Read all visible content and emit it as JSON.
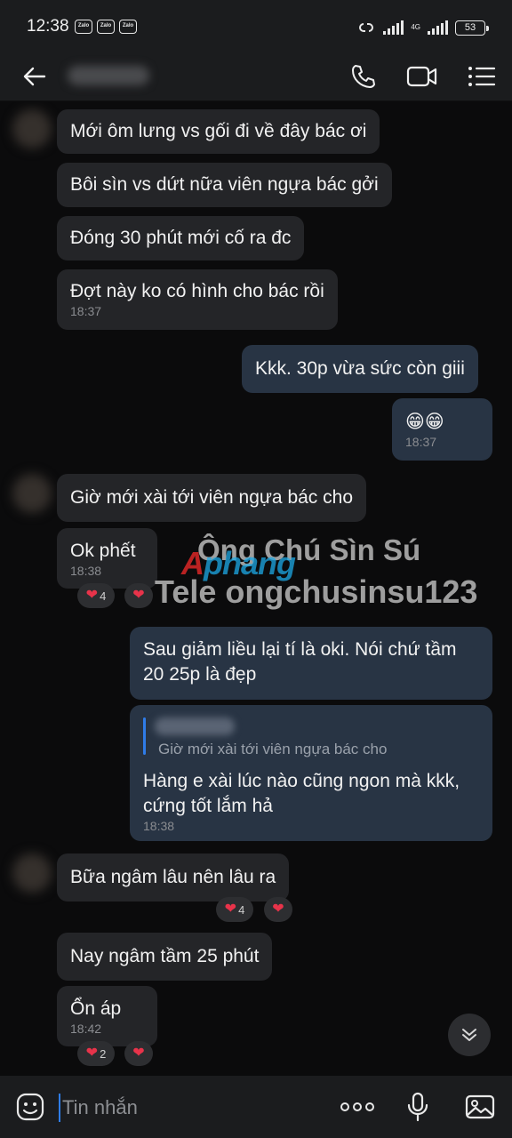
{
  "status_bar": {
    "time": "12:38",
    "app_badges": [
      "Zalo",
      "Zalo",
      "Zalo"
    ],
    "network": "4G",
    "battery": "53"
  },
  "header": {
    "icons": [
      "back-arrow-icon",
      "phone-icon",
      "video-call-icon",
      "menu-list-icon"
    ]
  },
  "messages": [
    {
      "dir": "in",
      "text": "Mới ôm lưng vs gối đi về đây bác ơi"
    },
    {
      "dir": "in",
      "text": "Bôi sìn vs dứt nữa viên ngựa bác gởi"
    },
    {
      "dir": "in",
      "text": "Đóng 30 phút mới cố ra đc"
    },
    {
      "dir": "in",
      "text": "Đợt này ko có hình cho bác rồi",
      "time": "18:37"
    },
    {
      "dir": "out",
      "text": "Kkk. 30p vừa sức còn giii"
    },
    {
      "dir": "out",
      "text": "😁😁",
      "time": "18:37"
    },
    {
      "dir": "in",
      "text": "Giờ mới xài tới viên ngựa bác cho"
    },
    {
      "dir": "in",
      "text": "Ok phết",
      "time": "18:38",
      "reaction_count": "4"
    },
    {
      "dir": "out",
      "text": "Sau giảm liều lại tí là oki. Nói chứ tầm 20 25p là đẹp"
    },
    {
      "dir": "out",
      "reply_quote": "Giờ mới xài tới viên ngựa bác cho",
      "text": "Hàng e xài lúc nào cũng ngon mà kkk, cứng tốt lắm hả",
      "time": "18:38"
    },
    {
      "dir": "in",
      "text": "Bữa ngâm lâu nên lâu ra",
      "reaction_count": "4"
    },
    {
      "dir": "in",
      "text": "Nay ngâm tầm 25 phút"
    },
    {
      "dir": "in",
      "text": "Ổn áp",
      "time": "18:42",
      "reaction_count": "2"
    }
  ],
  "watermark": {
    "line1": "Ông Chú Sìn Sú",
    "logo": "Aphang",
    "line2": "Tele ongchusinsu123"
  },
  "input": {
    "placeholder": "Tin nhắn"
  },
  "colors": {
    "background": "#0b0b0c",
    "bar": "#1b1c1e",
    "incoming_bubble": "#242528",
    "outgoing_bubble": "#283444",
    "accent": "#2f7ce8",
    "heart": "#e8334a"
  }
}
